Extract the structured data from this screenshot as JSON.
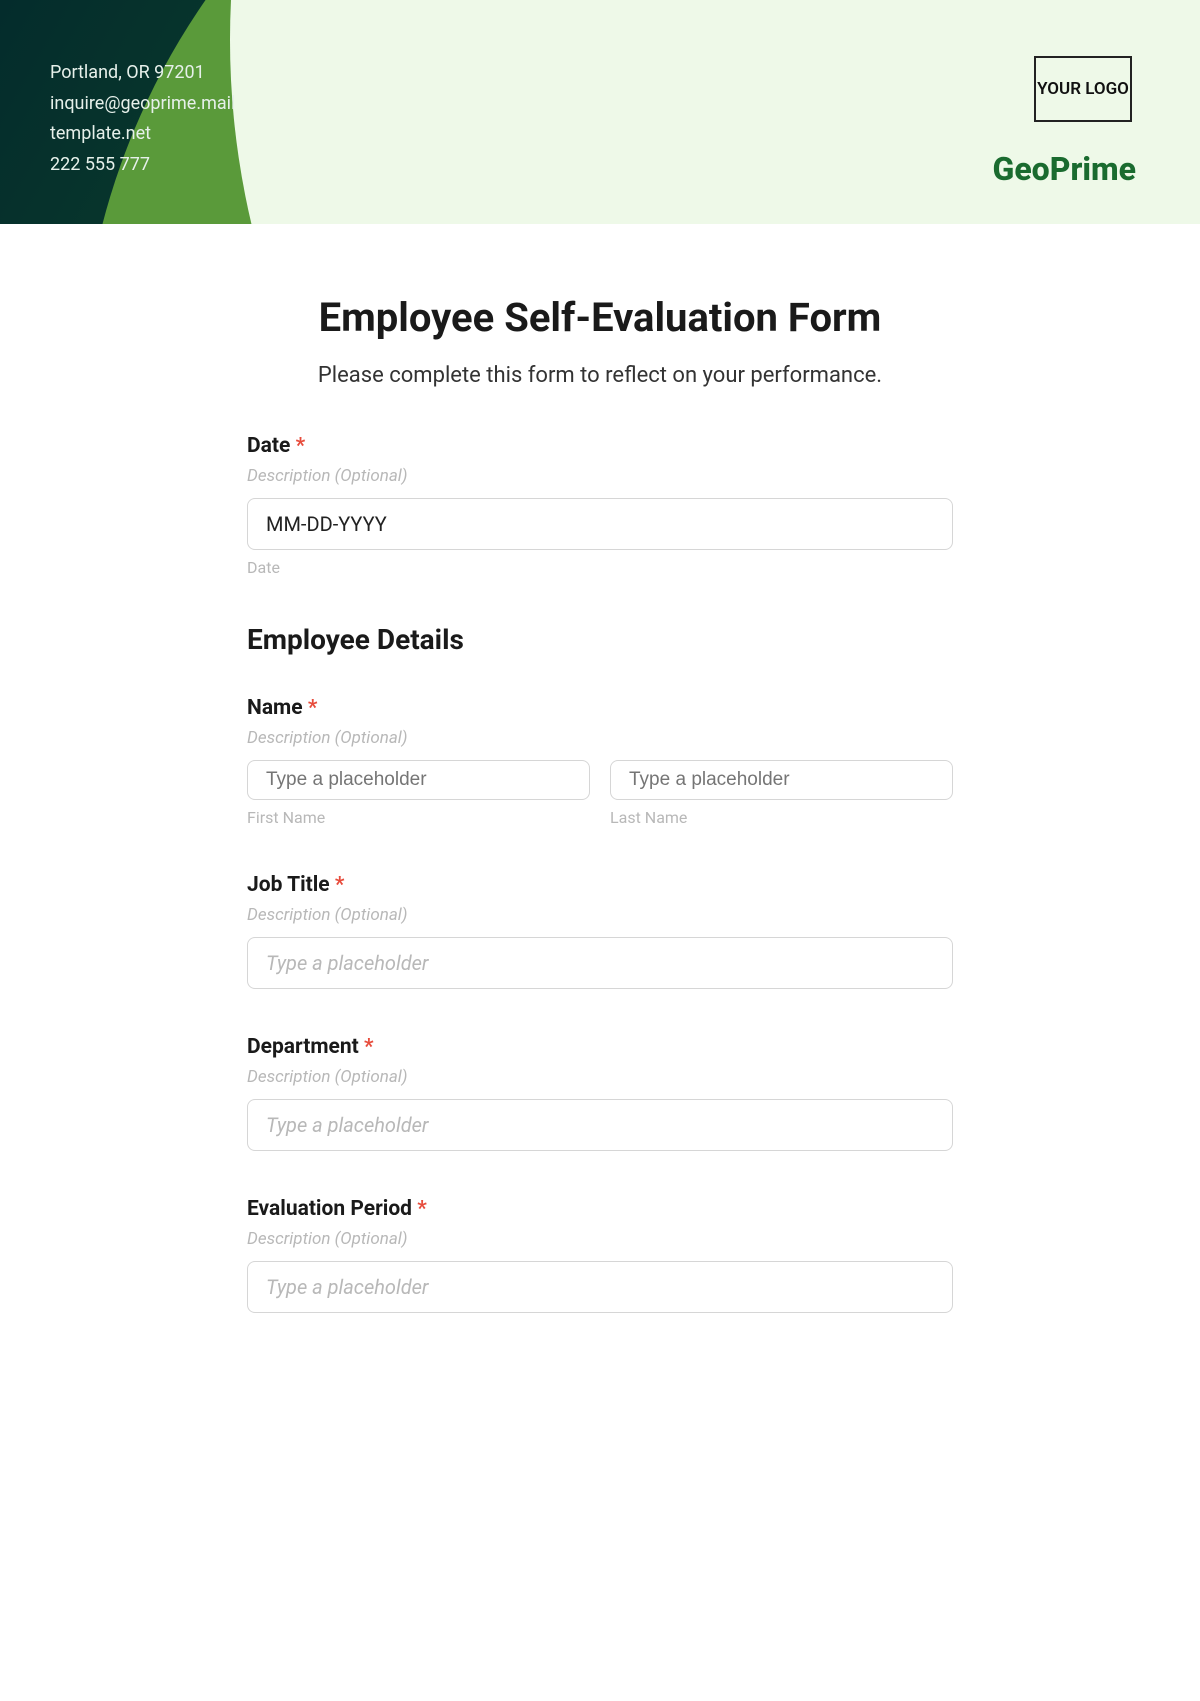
{
  "header": {
    "contact": {
      "line1": "Portland, OR 97201",
      "line2": "inquire@geoprime.mail",
      "line3": "template.net",
      "line4": "222 555 777"
    },
    "logo_text": "YOUR LOGO",
    "brand": "GeoPrime"
  },
  "form": {
    "title": "Employee Self-Evaluation Form",
    "subtitle": "Please complete this form to reflect on your performance.",
    "required_mark": "*",
    "desc_placeholder": "Description (Optional)",
    "generic_placeholder": "Type a placeholder",
    "fields": {
      "date": {
        "label": "Date",
        "value": "MM-DD-YYYY",
        "sublabel": "Date"
      },
      "section_employee": "Employee Details",
      "name": {
        "label": "Name",
        "first_sublabel": "First Name",
        "last_sublabel": "Last Name",
        "first_placeholder": "Type a placeholder",
        "last_placeholder": "Type a placeholder"
      },
      "job_title": {
        "label": "Job Title"
      },
      "department": {
        "label": "Department"
      },
      "evaluation_period": {
        "label": "Evaluation Period"
      }
    }
  }
}
